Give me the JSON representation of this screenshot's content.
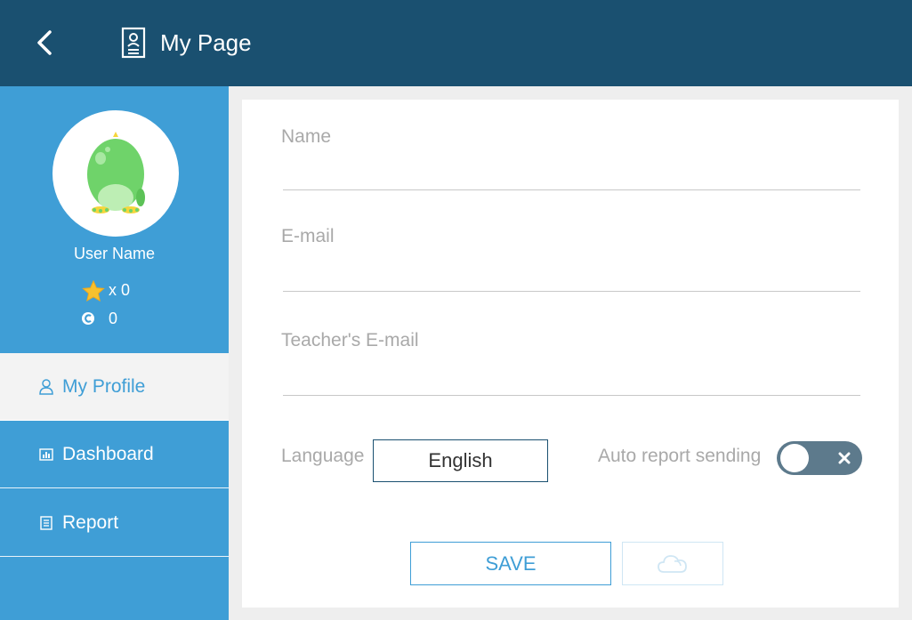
{
  "header": {
    "title": "My Page",
    "back_icon": "chevron-left-icon",
    "page_icon": "user-document-icon",
    "background": "#1a5070"
  },
  "profile": {
    "user_name": "User Name",
    "stars_text": "x 0",
    "coins_text": "0",
    "star_icon": "star-icon",
    "coin_icon": "coin-icon",
    "avatar_icon": "green-creature-avatar"
  },
  "sidebar": {
    "background": "#3f9ed6",
    "items": [
      {
        "label": "My Profile",
        "icon": "user-icon",
        "active": true
      },
      {
        "label": "Dashboard",
        "icon": "chart-icon",
        "active": false
      },
      {
        "label": "Report",
        "icon": "document-icon",
        "active": false
      }
    ]
  },
  "form": {
    "name_label": "Name",
    "name_value": "",
    "email_label": "E-mail",
    "email_value": "",
    "teacher_email_label": "Teacher's E-mail",
    "teacher_email_value": "",
    "language_label": "Language",
    "language_value": "English",
    "auto_report_label": "Auto report sending",
    "auto_report_on": false,
    "save_label": "SAVE",
    "cloud_icon": "cloud-sync-icon"
  }
}
